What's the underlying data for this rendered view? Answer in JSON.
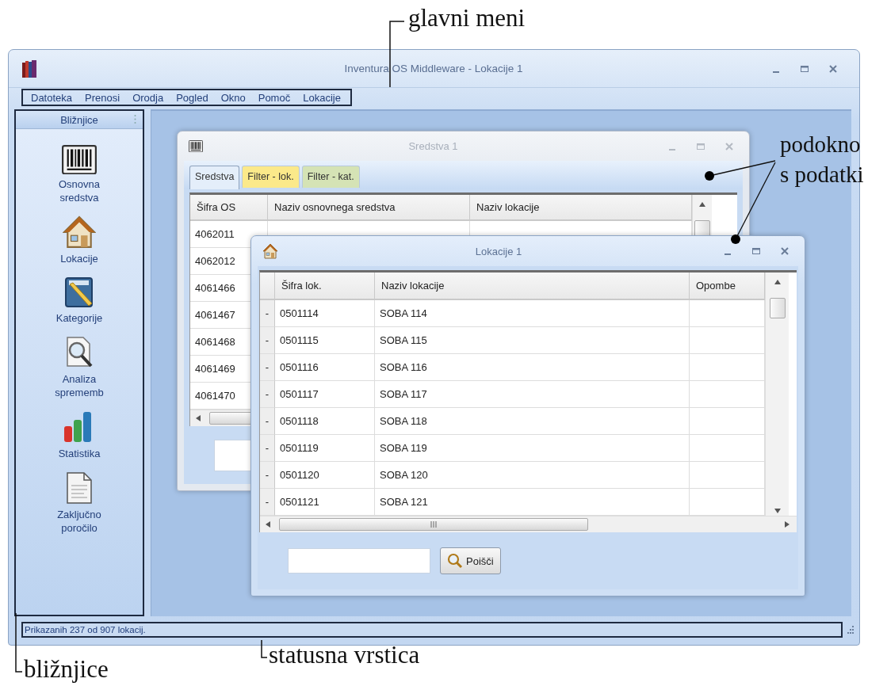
{
  "annotations": [
    {
      "text": "glavni meni"
    },
    {
      "text": "podokno s podatki"
    },
    {
      "text": "bližnjice"
    },
    {
      "text": "statusna vrstica"
    }
  ],
  "window": {
    "title": "Inventura OS Middleware - Lokacije 1",
    "menu": [
      {
        "label": "Datoteka"
      },
      {
        "label": "Prenosi"
      },
      {
        "label": "Orodja"
      },
      {
        "label": "Pogled"
      },
      {
        "label": "Okno"
      },
      {
        "label": "Pomoč"
      },
      {
        "label": "Lokacije"
      }
    ],
    "sidebar": {
      "title": "Bližnjice",
      "items": [
        {
          "label": "Osnovna sredstva"
        },
        {
          "label": "Lokacije"
        },
        {
          "label": "Kategorije"
        },
        {
          "label": "Analiza sprememb"
        },
        {
          "label": "Statistika"
        },
        {
          "label": "Zaključno poročilo"
        }
      ]
    },
    "child_windows": [
      {
        "title": "Sredstva 1",
        "active": false,
        "tabs": [
          {
            "label": "Sredstva",
            "selected": true,
            "color": "#e4eefa"
          },
          {
            "label": "Filter - lok.",
            "selected": false,
            "color": "#fbe98a"
          },
          {
            "label": "Filter - kat.",
            "selected": false,
            "color": "#d5e3b5"
          }
        ],
        "columns": [
          "Šifra OS",
          "Naziv osnovnega sredstva",
          "Naziv lokacije"
        ],
        "rows": [
          {
            "cells": [
              "4062011"
            ]
          },
          {
            "cells": [
              "4062012"
            ]
          },
          {
            "cells": [
              "4061466"
            ]
          },
          {
            "cells": [
              "4061467"
            ]
          },
          {
            "cells": [
              "4061468"
            ]
          },
          {
            "cells": [
              "4061469"
            ]
          },
          {
            "cells": [
              "4061470"
            ]
          }
        ]
      },
      {
        "title": "Lokacije 1",
        "active": true,
        "columns": [
          "Šifra lok.",
          "Naziv lokacije",
          "Opombe"
        ],
        "rows": [
          {
            "marker": "-",
            "cells": [
              "0501114",
              "SOBA 114"
            ]
          },
          {
            "marker": "-",
            "cells": [
              "0501115",
              "SOBA 115"
            ]
          },
          {
            "marker": "-",
            "cells": [
              "0501116",
              "SOBA 116"
            ]
          },
          {
            "marker": "-",
            "cells": [
              "0501117",
              "SOBA 117"
            ]
          },
          {
            "marker": "-",
            "cells": [
              "0501118",
              "SOBA 118"
            ]
          },
          {
            "marker": "-",
            "cells": [
              "0501119",
              "SOBA 119"
            ]
          },
          {
            "marker": "-",
            "cells": [
              "0501120",
              "SOBA 120"
            ]
          },
          {
            "marker": "-",
            "cells": [
              "0501121",
              "SOBA 121"
            ]
          }
        ],
        "button": "Poišči"
      }
    ],
    "status_bar": {
      "text": "Prikazanih 237 od 907 lokacij."
    }
  }
}
